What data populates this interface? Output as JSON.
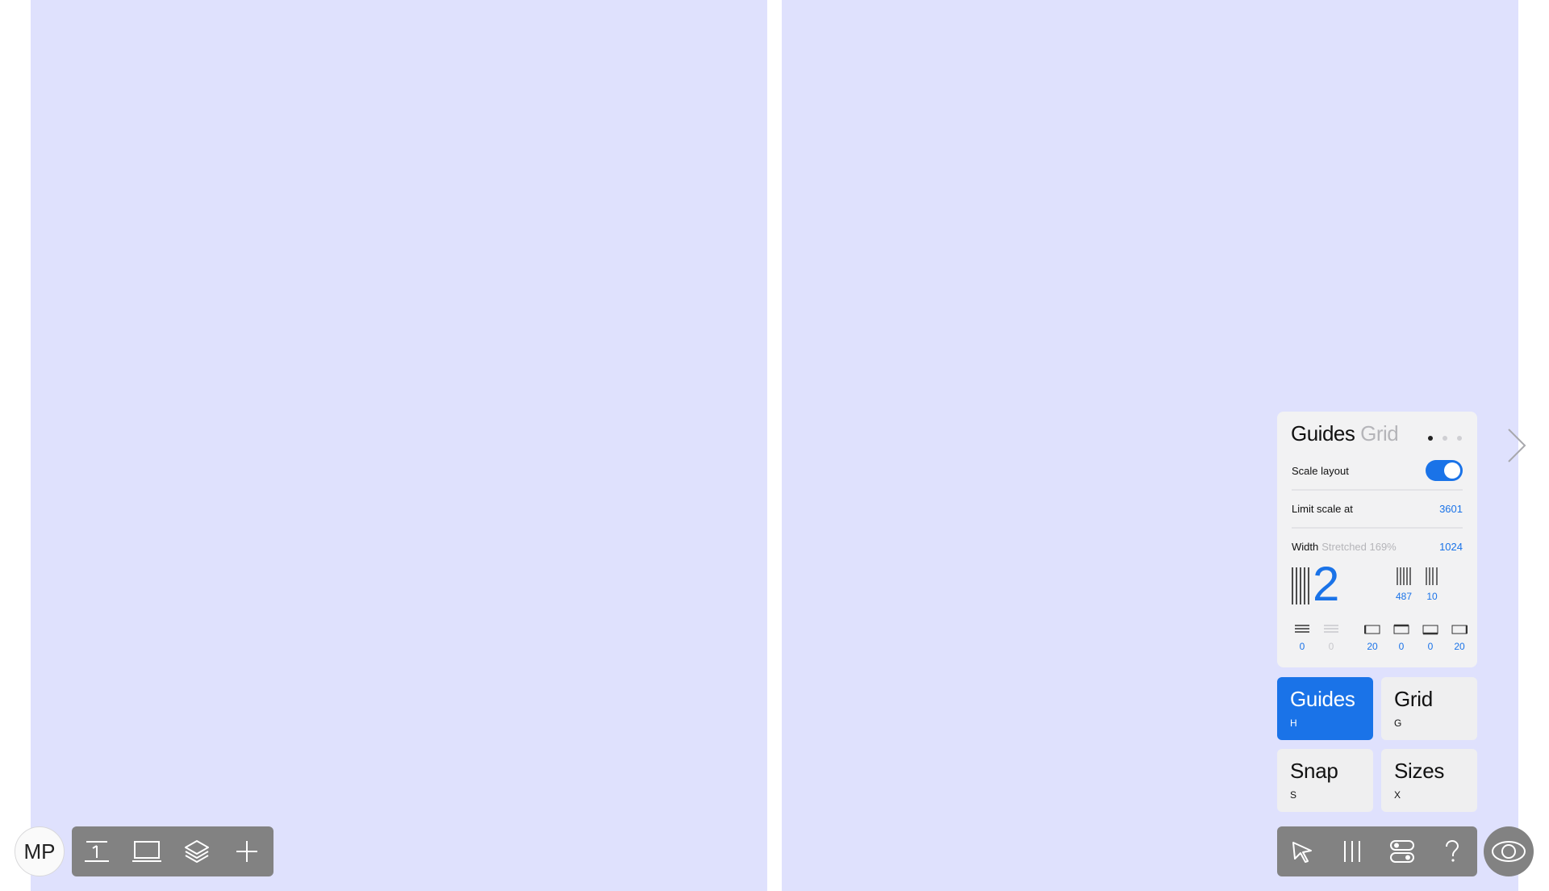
{
  "panel": {
    "title_primary": "Guides",
    "title_secondary": "Grid",
    "scale_layout_label": "Scale layout",
    "scale_layout_enabled": true,
    "limit_scale_label": "Limit scale at",
    "limit_scale_value": "3601",
    "width_label": "Width",
    "width_sub": "Stretched 169%",
    "width_value": "1024",
    "columns_count": "2",
    "column_width": "487",
    "gutter": "10",
    "rows_value": "0",
    "rows_gutter_value": "0",
    "margin_left": "20",
    "margin_top": "0",
    "margin_bottom": "0",
    "margin_right": "20"
  },
  "tiles": {
    "guides": {
      "name": "Guides",
      "key": "H",
      "active": true
    },
    "grid": {
      "name": "Grid",
      "key": "G"
    },
    "snap": {
      "name": "Snap",
      "key": "S"
    },
    "sizes": {
      "name": "Sizes",
      "key": "X"
    }
  },
  "avatar": {
    "initials": "MP"
  },
  "left_toolbar_icons": [
    "text-baseline-icon",
    "laptop-icon",
    "layers-icon",
    "plus-icon"
  ],
  "right_toolbar_icons": [
    "cursor-icon",
    "columns-icon",
    "toggles-icon",
    "help-icon"
  ],
  "colors": {
    "accent": "#1a73e8",
    "column_fill": "#dfe1fd",
    "toolbar": "#828282"
  }
}
